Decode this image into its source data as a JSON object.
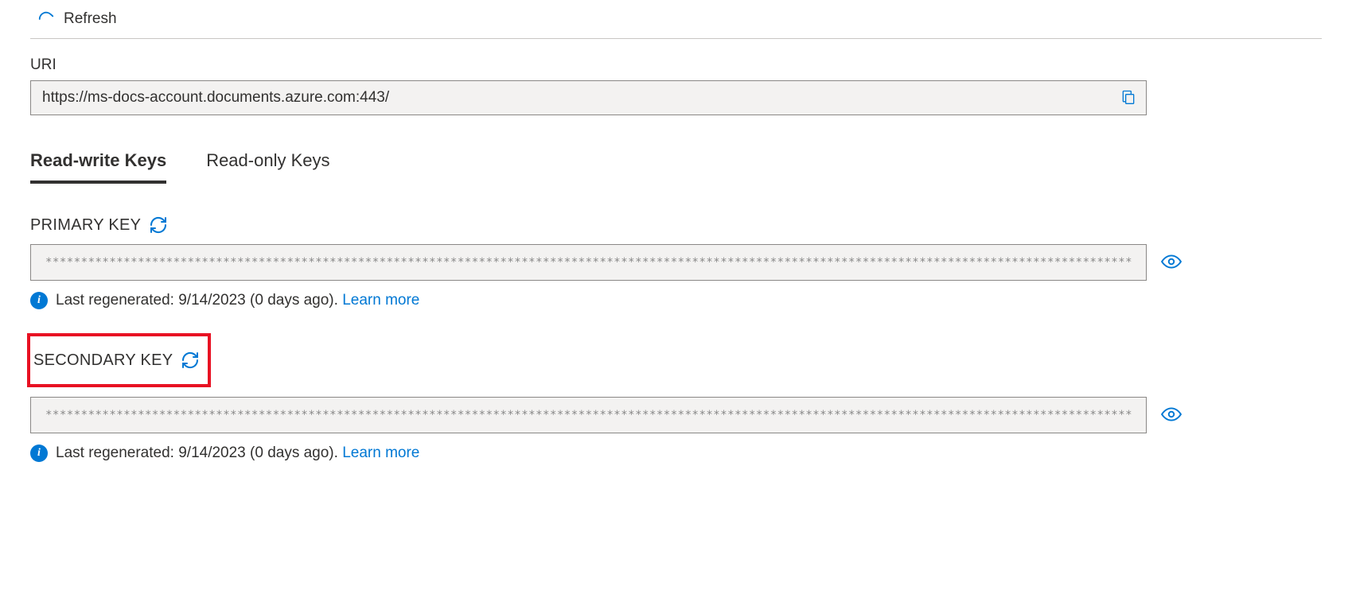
{
  "toolbar": {
    "refresh_label": "Refresh"
  },
  "uri": {
    "label": "URI",
    "value": "https://ms-docs-account.documents.azure.com:443/"
  },
  "tabs": {
    "read_write": "Read-write Keys",
    "read_only": "Read-only Keys"
  },
  "primary": {
    "label": "PRIMARY KEY",
    "masked": "************************************************************************************************************************************************************************************************************",
    "info_text": "Last regenerated: 9/14/2023 (0 days ago). ",
    "learn_more": "Learn more"
  },
  "secondary": {
    "label": "SECONDARY KEY",
    "masked": "************************************************************************************************************************************************************************************************************",
    "info_text": "Last regenerated: 9/14/2023 (0 days ago). ",
    "learn_more": "Learn more"
  }
}
